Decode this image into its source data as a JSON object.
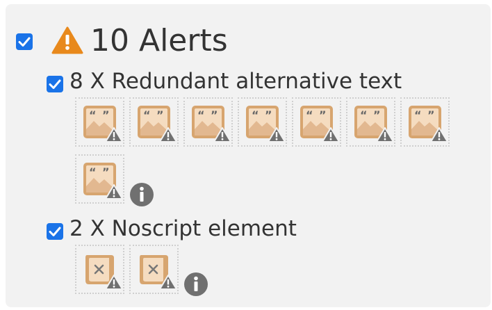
{
  "header": {
    "title": "10 Alerts",
    "checked": true,
    "icon": "warning-icon",
    "accent_color": "#e8891c"
  },
  "groups": [
    {
      "title": "8 X Redundant alternative text",
      "checked": true,
      "item_icon": "redundant-alt-text-icon",
      "item_count": 8,
      "info_icon": "info-icon"
    },
    {
      "title": "2 X Noscript element",
      "checked": true,
      "item_icon": "noscript-element-icon",
      "item_count": 2,
      "info_icon": "info-icon"
    }
  ],
  "colors": {
    "checkbox": "#1a73e8",
    "panel_background": "#f2f2f2",
    "icon_tan": "#d7a56f",
    "info_icon": "#707070"
  }
}
